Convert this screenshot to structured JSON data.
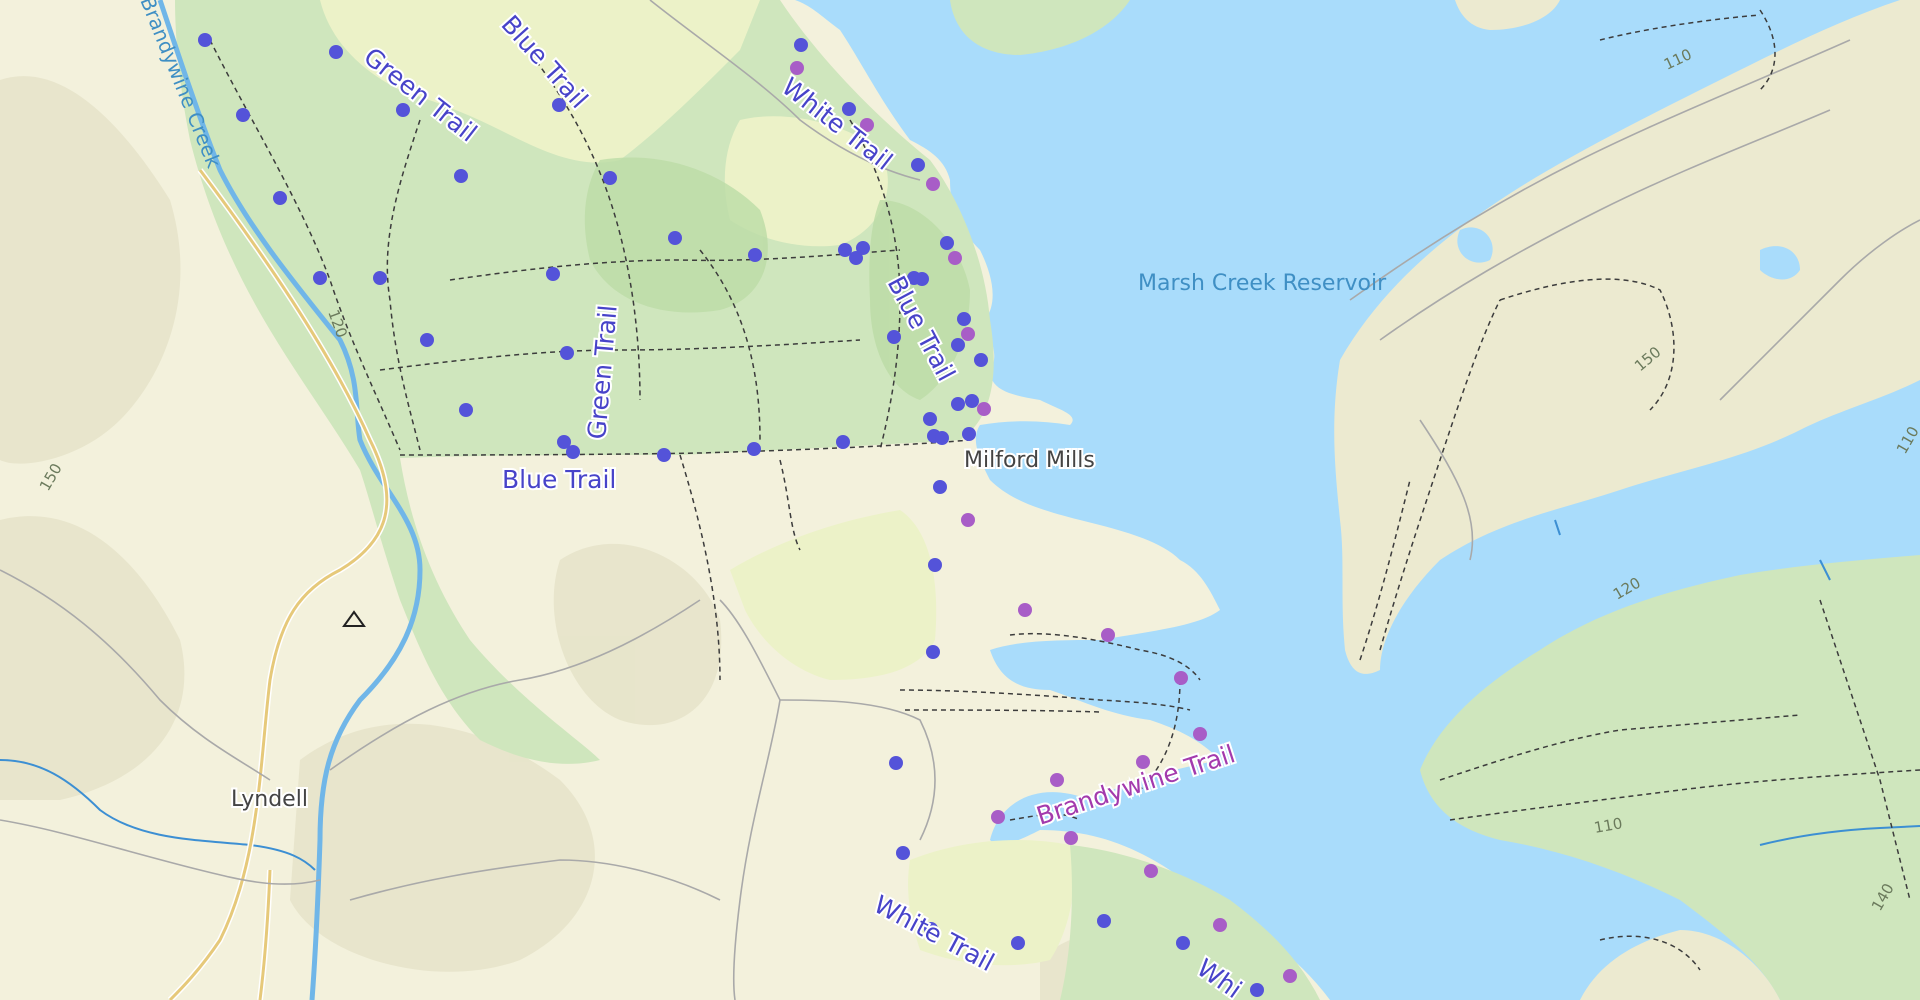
{
  "map": {
    "colors": {
      "land": "#f3f1dc",
      "forest": "#cfe6bd",
      "meadow": "#ecf2c8",
      "water": "#a9dcfb",
      "road": "#a9a9a9",
      "path": "#444444",
      "blue_trail": "#5453d9",
      "purple_trail": "#a85dc7",
      "water_label": "#3f8fc4",
      "place_label": "#444444",
      "trail_label_blue": "#4743c9",
      "trail_label_purple": "#a33aad"
    },
    "labels": {
      "reservoir": "Marsh Creek Reservoir",
      "milford_mills": "Milford Mills",
      "lyndell": "Lyndell",
      "creek": "Brandywine Creek",
      "trail_blue_1": "Blue Trail",
      "trail_blue_2": "Blue Trail",
      "trail_blue_3": "Blue Trail",
      "trail_green_1": "Green Trail",
      "trail_green_2": "Green Trail",
      "trail_white_1": "White Trail",
      "trail_white_2": "White Trail",
      "trail_white_3": "Whi",
      "trail_brandywine": "Brandywine Trail",
      "contour_120a": "120",
      "contour_150a": "150",
      "contour_110a": "110",
      "contour_150b": "150",
      "contour_120b": "120",
      "contour_110b": "110",
      "contour_140": "140",
      "contour_110c": "110"
    },
    "icons": {
      "campsite": "campsite-icon"
    }
  }
}
